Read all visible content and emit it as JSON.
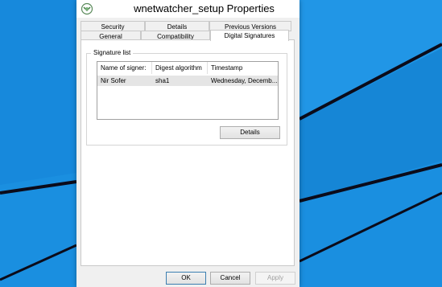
{
  "window": {
    "title": "wnetwatcher_setup Properties"
  },
  "tabs_top": [
    {
      "label": "Security"
    },
    {
      "label": "Details"
    },
    {
      "label": "Previous Versions"
    }
  ],
  "tabs_bottom": [
    {
      "label": "General"
    },
    {
      "label": "Compatibility"
    },
    {
      "label": "Digital Signatures"
    }
  ],
  "signature_list": {
    "legend": "Signature list",
    "columns": [
      "Name of signer:",
      "Digest algorithm",
      "Timestamp"
    ],
    "rows": [
      {
        "name": "Nir Sofer",
        "digest": "sha1",
        "timestamp": "Wednesday, Decemb..."
      }
    ]
  },
  "buttons": {
    "details": "Details",
    "ok": "OK",
    "cancel": "Cancel",
    "apply": "Apply"
  },
  "colors": {
    "desktop": "#1a8fe0",
    "selected_row": "#e5e5e5"
  }
}
